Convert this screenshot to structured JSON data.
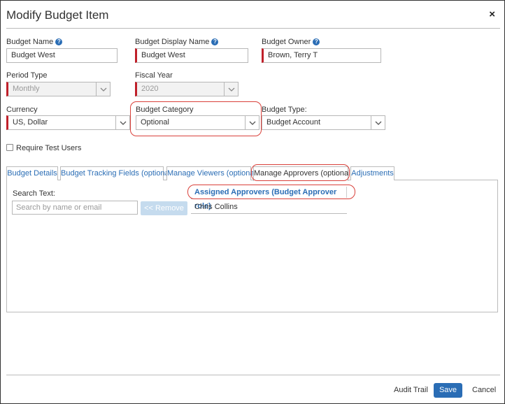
{
  "dialog": {
    "title": "Modify Budget Item",
    "close_glyph": "×"
  },
  "form": {
    "budget_name": {
      "label": "Budget Name",
      "value": "Budget West"
    },
    "budget_display_name": {
      "label": "Budget Display Name",
      "value": "Budget West"
    },
    "budget_owner": {
      "label": "Budget Owner",
      "value": "Brown, Terry T"
    },
    "period_type": {
      "label": "Period Type",
      "value": "Monthly"
    },
    "fiscal_year": {
      "label": "Fiscal Year",
      "value": "2020"
    },
    "currency": {
      "label": "Currency",
      "value": "US, Dollar"
    },
    "budget_category": {
      "label": "Budget Category",
      "value": "Optional"
    },
    "budget_type": {
      "label": "Budget Type:",
      "value": "Budget Account"
    },
    "require_test_users": {
      "label": "Require Test Users",
      "checked": false
    },
    "help_glyph": "?"
  },
  "tabs": [
    {
      "label": "Budget Details"
    },
    {
      "label": "Budget Tracking Fields (optional)"
    },
    {
      "label": "Manage Viewers (optional)"
    },
    {
      "label": "Manage Approvers (optional)",
      "active": true
    },
    {
      "label": "Adjustments"
    }
  ],
  "approvers": {
    "search_label": "Search Text:",
    "search_placeholder": "Search by name or email",
    "remove_button": "<< Remove",
    "column_header": "Assigned Approvers (Budget Approver role)",
    "rows": [
      "Chris Collins"
    ]
  },
  "footer": {
    "audit_trail": "Audit Trail",
    "save": "Save",
    "cancel": "Cancel"
  },
  "colors": {
    "accent": "#2a6db5",
    "required_marker": "#c0202a",
    "highlight_outline": "#d9403a"
  },
  "icons": {
    "help": "help-circle-icon",
    "dropdown": "chevron-down-icon",
    "close": "close-icon"
  }
}
